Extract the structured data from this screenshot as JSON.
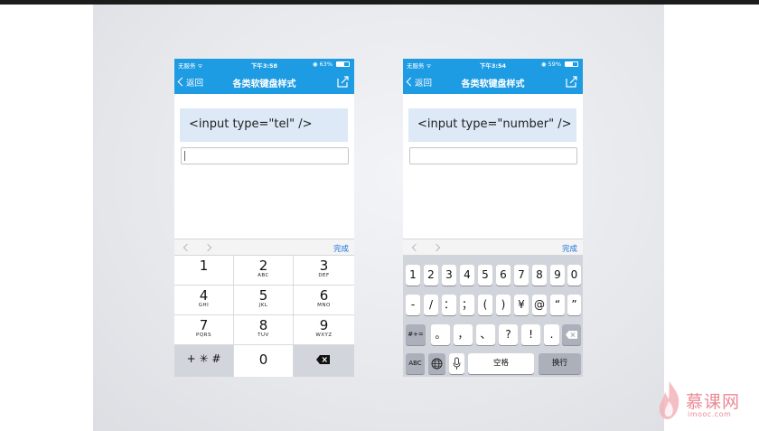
{
  "colors": {
    "nav": "#1d9be3",
    "accent": "#1a73d9",
    "watermark": "#e98a95"
  },
  "phones": [
    {
      "status": {
        "carrier": "无服务 ᯤ",
        "time": "下午3:58",
        "battery": "◉ 63%"
      },
      "nav": {
        "back": "返回",
        "title": "各类软键盘样式"
      },
      "code": "<input type=\"tel\" />",
      "input_value": "",
      "accessory_done": "完成",
      "battery_level": 0.63
    },
    {
      "status": {
        "carrier": "无服务 ᯤ",
        "time": "下午3:54",
        "battery": "◉ 59%"
      },
      "nav": {
        "back": "返回",
        "title": "各类软键盘样式"
      },
      "code": "<input type=\"number\" />",
      "input_value": "",
      "accessory_done": "完成",
      "battery_level": 0.59
    }
  ],
  "tel_keys": [
    {
      "digit": "1",
      "letters": ""
    },
    {
      "digit": "2",
      "letters": "ABC"
    },
    {
      "digit": "3",
      "letters": "DEF"
    },
    {
      "digit": "4",
      "letters": "GHI"
    },
    {
      "digit": "5",
      "letters": "JKL"
    },
    {
      "digit": "6",
      "letters": "MNO"
    },
    {
      "digit": "7",
      "letters": "PQRS"
    },
    {
      "digit": "8",
      "letters": "TUV"
    },
    {
      "digit": "9",
      "letters": "WXYZ"
    },
    {
      "sym": "+ ✳ #"
    },
    {
      "digit": "0",
      "letters": ""
    },
    {
      "icon": "delete-icon"
    }
  ],
  "number_keys": {
    "row1": [
      "1",
      "2",
      "3",
      "4",
      "5",
      "6",
      "7",
      "8",
      "9",
      "0"
    ],
    "row2": [
      "-",
      "/",
      "：",
      "；",
      "(",
      ")",
      "¥",
      "@",
      "“",
      "”"
    ],
    "row3": [
      "#+=",
      "。",
      "，",
      "、",
      "?",
      "!",
      "."
    ],
    "row4": {
      "abc": "ABC",
      "space": "空格",
      "return": "换行"
    }
  },
  "watermark": {
    "brand": "慕课网",
    "url": "imooc.com"
  }
}
